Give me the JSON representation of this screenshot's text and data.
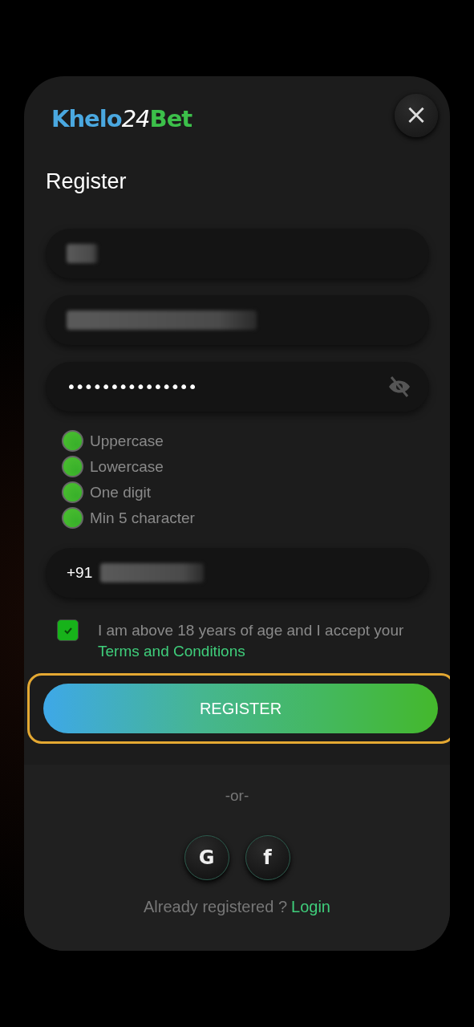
{
  "logo": {
    "parts": [
      {
        "text": "Khelo",
        "color": "#4aa8e0"
      },
      {
        "text": "24",
        "color": "#ffffff"
      },
      {
        "text": "Bet",
        "color": "#3cc04a"
      }
    ]
  },
  "close_button": {
    "label": "×"
  },
  "title": "Register",
  "fields": [
    {
      "kind": "redacted"
    },
    {
      "kind": "redacted"
    },
    {
      "kind": "password",
      "value": "•••••••••••••••"
    },
    {
      "kind": "phone",
      "prefix": "+91"
    }
  ],
  "password_rules": [
    {
      "label": "Uppercase",
      "met": true
    },
    {
      "label": "Lowercase",
      "met": true
    },
    {
      "label": "One digit",
      "met": true
    },
    {
      "label": "Min 5 character",
      "met": true
    }
  ],
  "agreement": {
    "checked": true,
    "text": "I am above 18 years of age and I accept your",
    "link": "Terms and Conditions"
  },
  "register_button": {
    "label": "REGISTER",
    "focused": true
  },
  "divider": "-or-",
  "social_buttons": [
    {
      "label": "G"
    },
    {
      "label": "f"
    }
  ],
  "footer": {
    "text": "Already registered ?",
    "link": "Login"
  }
}
